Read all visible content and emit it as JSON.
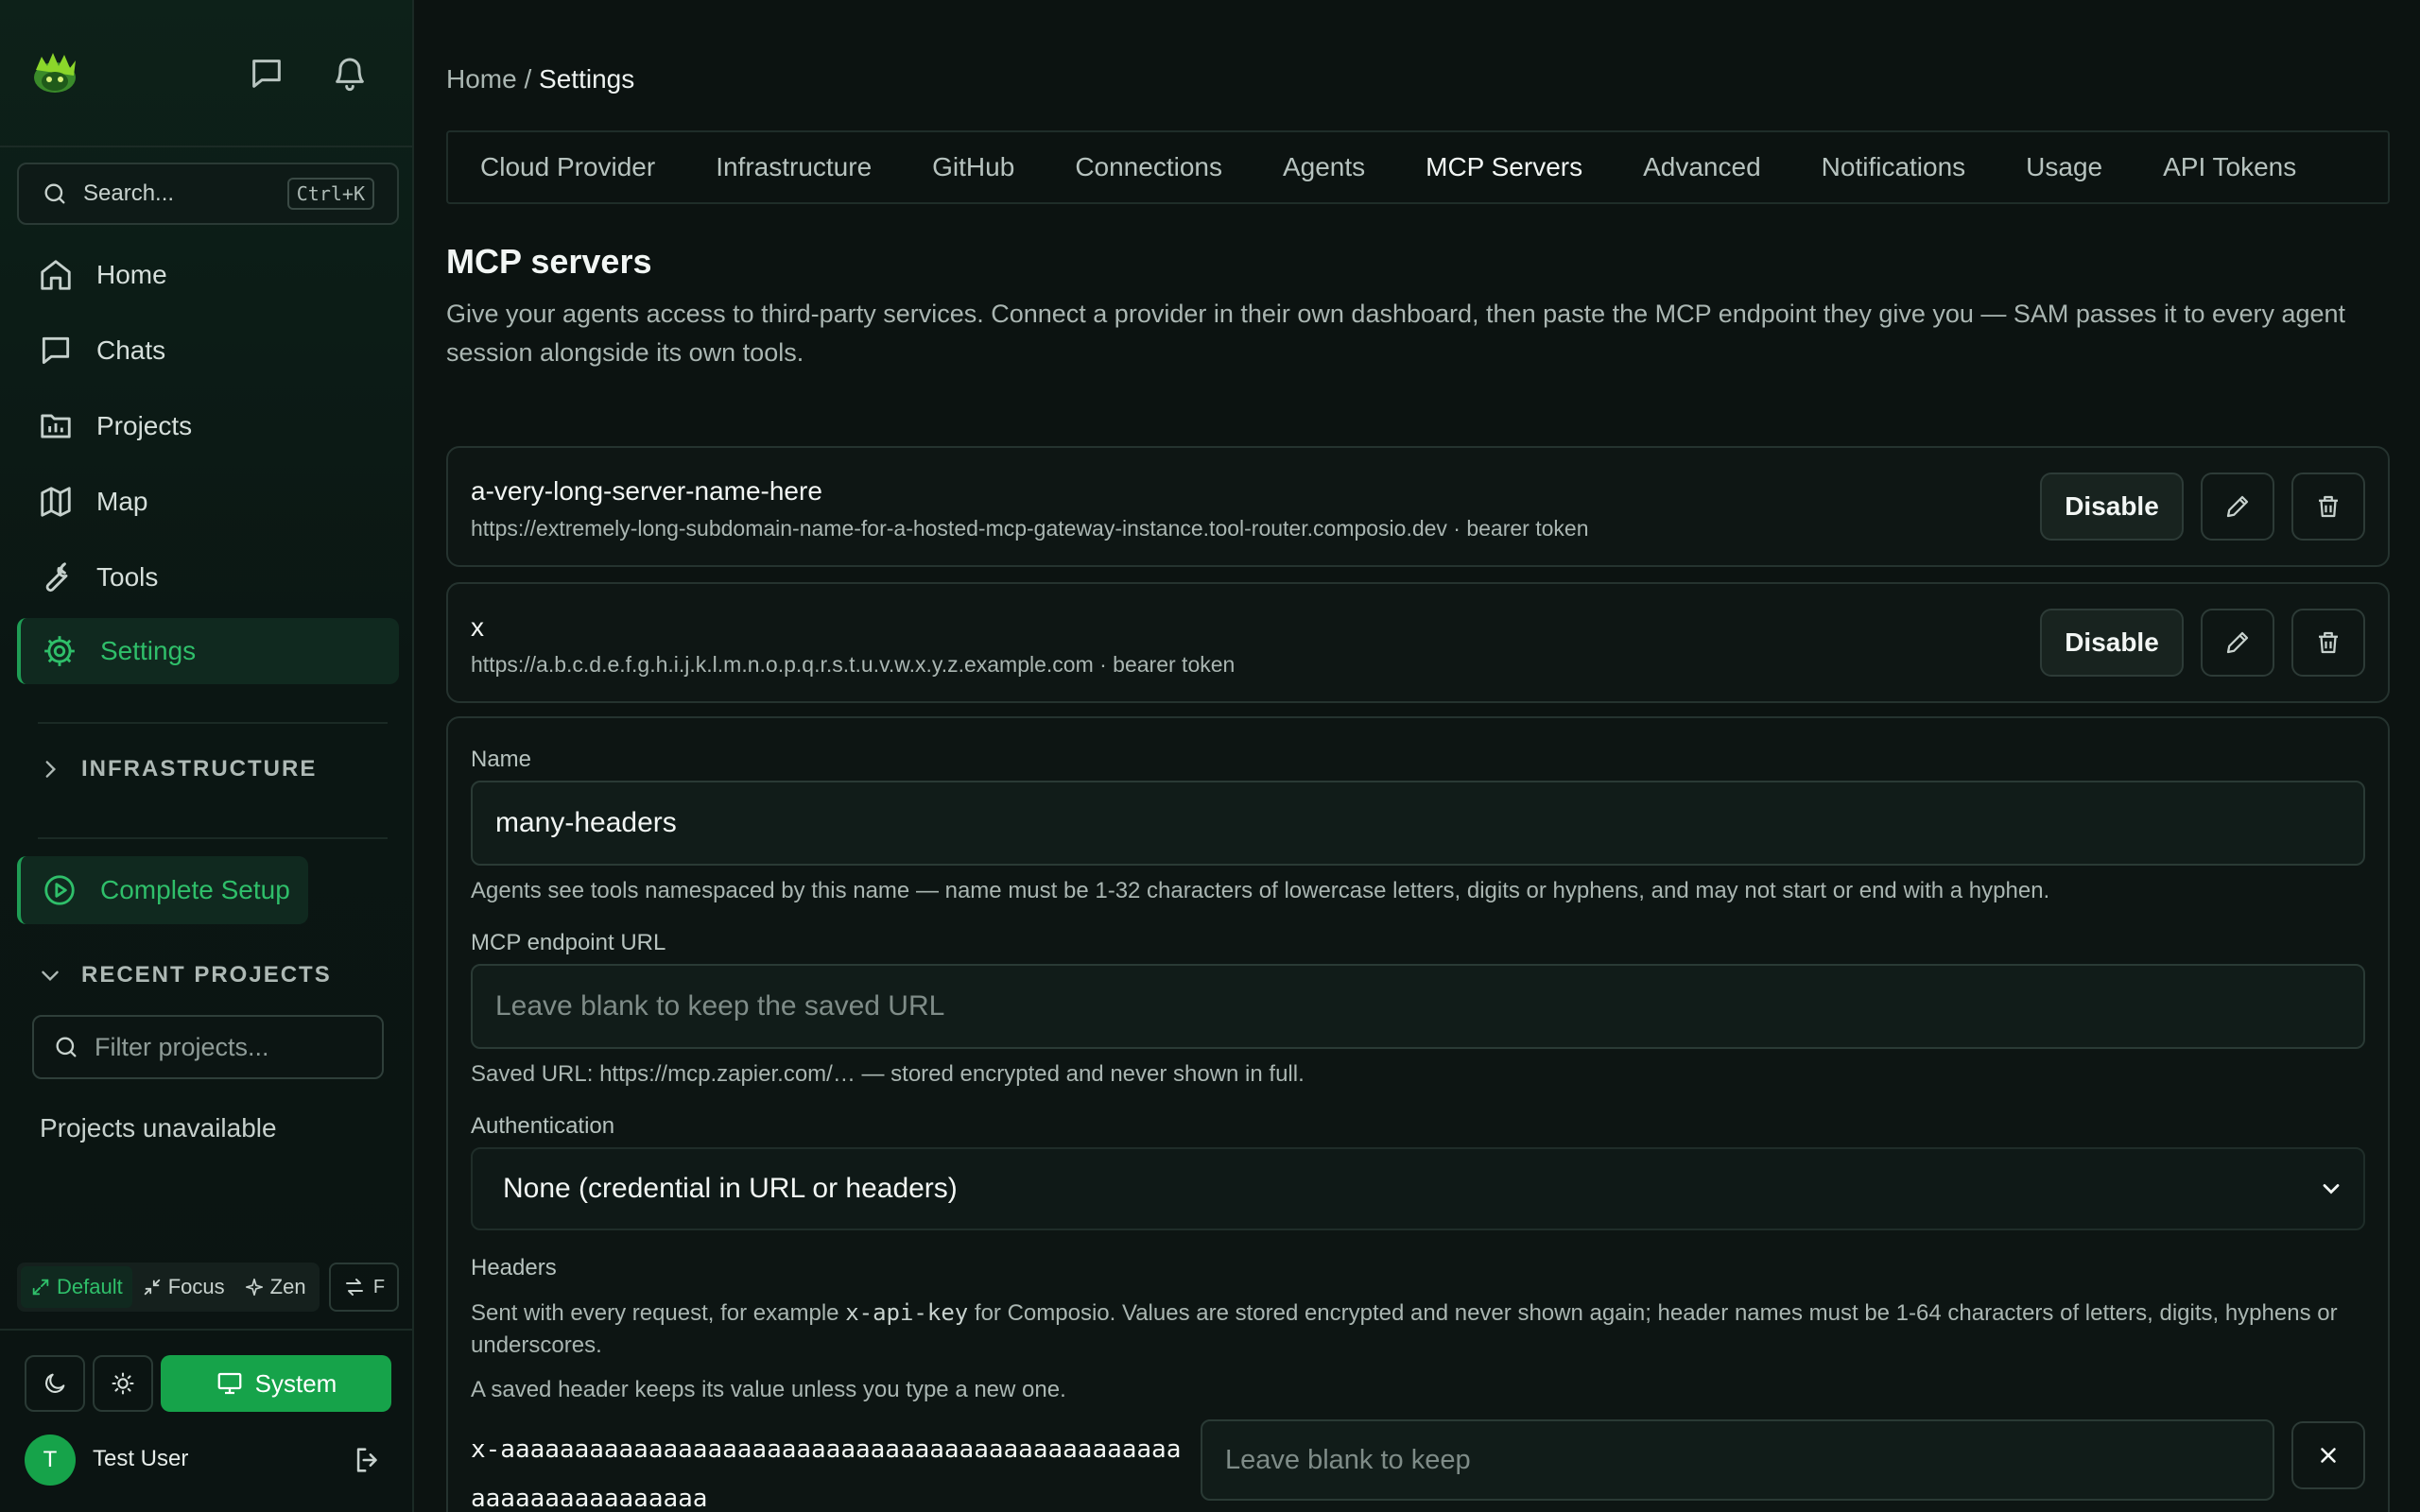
{
  "sidebar": {
    "search": {
      "label": "Search...",
      "shortcut": "Ctrl+K"
    },
    "nav": [
      {
        "label": "Home",
        "icon": "home-icon"
      },
      {
        "label": "Chats",
        "icon": "chat-icon"
      },
      {
        "label": "Projects",
        "icon": "folder-icon"
      },
      {
        "label": "Map",
        "icon": "map-icon"
      },
      {
        "label": "Tools",
        "icon": "wrench-icon"
      },
      {
        "label": "Settings",
        "icon": "gear-icon",
        "active": true
      }
    ],
    "infrastructure_label": "INFRASTRUCTURE",
    "complete_setup_label": "Complete Setup",
    "recent_projects_label": "RECENT PROJECTS",
    "filter_placeholder": "Filter projects...",
    "projects_status": "Projects unavailable",
    "modes": {
      "default": "Default",
      "focus": "Focus",
      "zen": "Zen",
      "swap_key": "F"
    },
    "theme": {
      "system_label": "System"
    },
    "user": {
      "initial": "T",
      "name": "Test User"
    }
  },
  "breadcrumb": {
    "home": "Home",
    "separator": " / ",
    "current": "Settings"
  },
  "tabs": [
    {
      "label": "Cloud Provider"
    },
    {
      "label": "Infrastructure"
    },
    {
      "label": "GitHub"
    },
    {
      "label": "Connections"
    },
    {
      "label": "Agents"
    },
    {
      "label": "MCP Servers",
      "active": true
    },
    {
      "label": "Advanced"
    },
    {
      "label": "Notifications"
    },
    {
      "label": "Usage"
    },
    {
      "label": "API Tokens"
    }
  ],
  "page": {
    "title": "MCP servers",
    "description": "Give your agents access to third-party services. Connect a provider in their own dashboard, then paste the MCP endpoint they give you — SAM passes it to every agent session alongside its own tools."
  },
  "servers": [
    {
      "name": "a-very-long-server-name-here",
      "url_line": "https://extremely-long-subdomain-name-for-a-hosted-mcp-gateway-instance.tool-router.composio.dev · bearer token",
      "disable_label": "Disable"
    },
    {
      "name": "x",
      "url_line": "https://a.b.c.d.e.f.g.h.i.j.k.l.m.n.o.p.q.r.s.t.u.v.w.x.y.z.example.com · bearer token",
      "disable_label": "Disable"
    }
  ],
  "form": {
    "name_label": "Name",
    "name_value": "many-headers",
    "name_help": "Agents see tools namespaced by this name — name must be 1-32 characters of lowercase letters, digits or hyphens, and may not start or end with a hyphen.",
    "url_label": "MCP endpoint URL",
    "url_placeholder": "Leave blank to keep the saved URL",
    "url_help": "Saved URL: https://mcp.zapier.com/… — stored encrypted and never shown in full.",
    "auth_label": "Authentication",
    "auth_value": "None (credential in URL or headers)",
    "headers_label": "Headers",
    "headers_help_pre": "Sent with every request, for example ",
    "headers_help_code": "x-api-key",
    "headers_help_post": " for Composio. Values are stored encrypted and never shown again; header names must be 1-64 characters of letters, digits, hyphens or underscores.",
    "headers_note": "A saved header keeps its value unless you type a new one.",
    "header_rows": [
      {
        "name": "x-aaaaaaaaaaaaaaaaaaaaaaaaaaaaaaaaaaaaaaaaaaaaaaaaaaaaaaaaaaaaaa",
        "value_placeholder": "Leave blank to keep"
      }
    ]
  }
}
